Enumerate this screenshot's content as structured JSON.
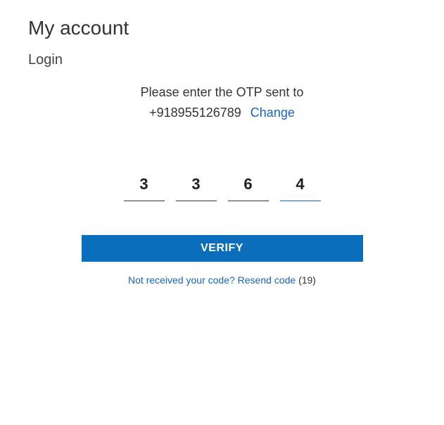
{
  "header": {
    "title": "My account",
    "subtitle": "Login"
  },
  "otp": {
    "instruction": "Please enter the OTP sent to",
    "phone": "+918955126789",
    "change_label": "Change",
    "digits": [
      "3",
      "3",
      "6",
      "4"
    ],
    "verify_label": "VERIFY",
    "resend_prefix": "Not received your code? ",
    "resend_action": "Resend code",
    "countdown": "(19)"
  }
}
